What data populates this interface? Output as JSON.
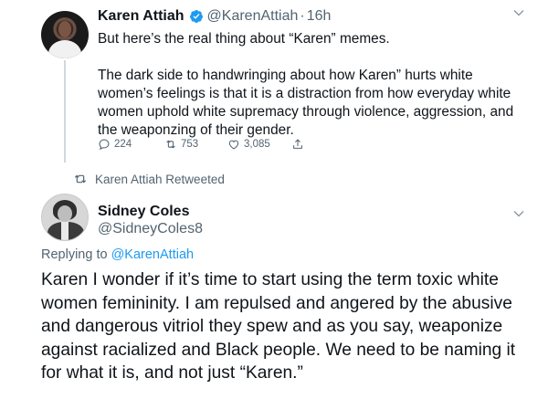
{
  "tweet1": {
    "name": "Karen Attiah",
    "handle": "@KarenAttiah",
    "separator": "·",
    "time": "16h",
    "paragraph1": "But here’s the real thing about “Karen” memes.",
    "paragraph2": "The dark side to handwringing about how Karen” hurts white women’s feelings is that it is a distraction from how everyday white women uphold white supremacy through violence, aggression, and the weaponzing of their gender.",
    "replies": "224",
    "retweets": "753",
    "likes": "3,085"
  },
  "retweet_notice": "Karen Attiah Retweeted",
  "tweet2": {
    "name": "Sidney Coles",
    "handle": "@SidneyColes8",
    "replying_prefix": "Replying to ",
    "replying_to": "@KarenAttiah",
    "text": "Karen I wonder if it’s time to start using the term toxic white women femininity. I am repulsed and angered by the abusive and dangerous vitriol they spew and as you say, weaponize against racialized and Black people. We need to be naming it for what it is, and not just “Karen.”"
  },
  "colors": {
    "text": "#0f1419",
    "secondary": "#536471",
    "accent": "#1d9bf0",
    "thread_line": "#cfd9de"
  },
  "icons": [
    "verified-badge-icon",
    "chevron-down-icon",
    "reply-icon",
    "retweet-icon",
    "like-icon",
    "share-icon"
  ]
}
